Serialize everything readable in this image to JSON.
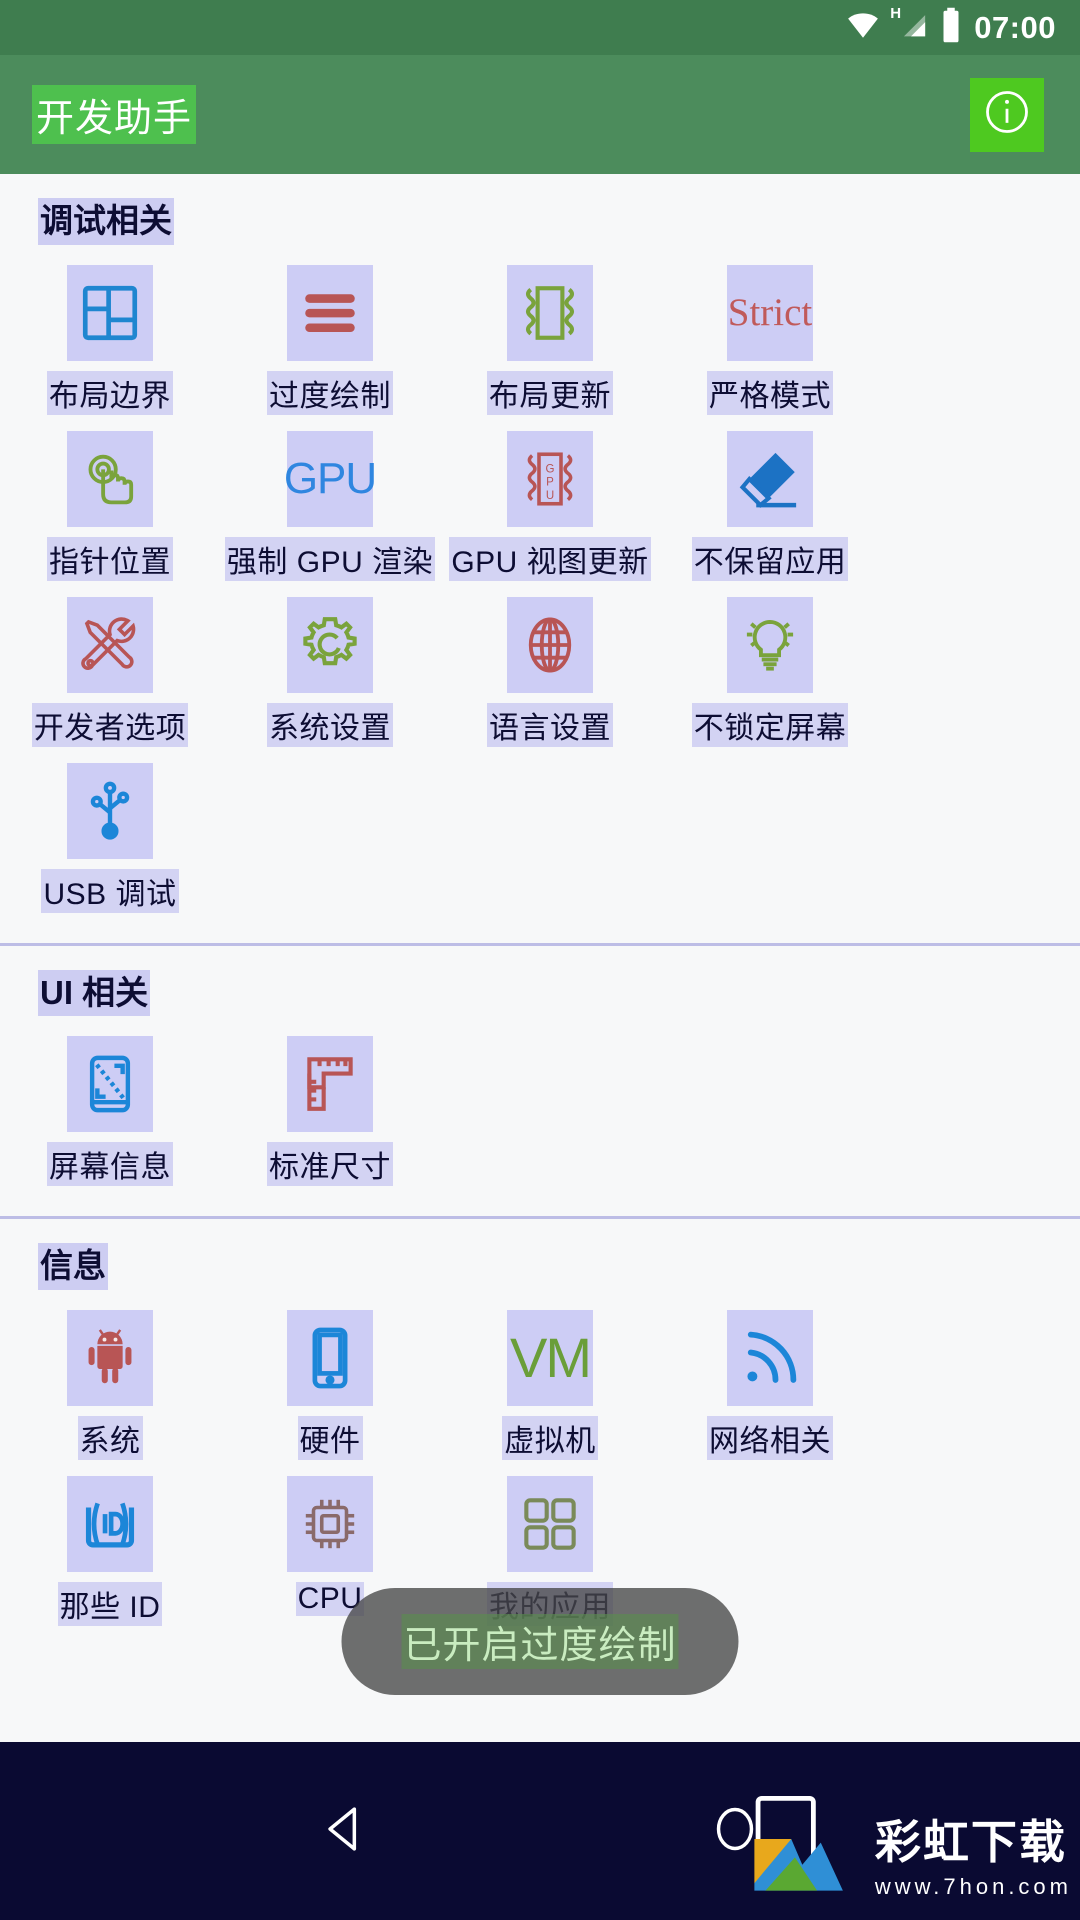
{
  "status_bar": {
    "time": "07:00",
    "icons": [
      "wifi-icon",
      "signal-h-icon",
      "battery-icon"
    ]
  },
  "app_bar": {
    "title": "开发助手",
    "info_button_icon": "info-circle-icon"
  },
  "sections": [
    {
      "title": "调试相关",
      "items": [
        {
          "label": "布局边界",
          "icon": "layout-bounds-icon"
        },
        {
          "label": "过度绘制",
          "icon": "overdraw-lines-icon"
        },
        {
          "label": "布局更新",
          "icon": "layout-update-icon"
        },
        {
          "label": "严格模式",
          "icon": "strict-mode-icon",
          "text": "Strict"
        },
        {
          "label": "指针位置",
          "icon": "pointer-location-icon"
        },
        {
          "label": "强制 GPU 渲染",
          "icon": "gpu-render-icon",
          "text": "GPU"
        },
        {
          "label": "GPU 视图更新",
          "icon": "gpu-view-update-icon",
          "text": "GPU"
        },
        {
          "label": "不保留应用",
          "icon": "dont-keep-activities-icon"
        },
        {
          "label": "开发者选项",
          "icon": "developer-tools-icon"
        },
        {
          "label": "系统设置",
          "icon": "gear-icon"
        },
        {
          "label": "语言设置",
          "icon": "globe-icon"
        },
        {
          "label": "不锁定屏幕",
          "icon": "lightbulb-icon"
        },
        {
          "label": "USB 调试",
          "icon": "usb-icon"
        }
      ]
    },
    {
      "title": "UI 相关",
      "items": [
        {
          "label": "屏幕信息",
          "icon": "screen-info-icon"
        },
        {
          "label": "标准尺寸",
          "icon": "ruler-icon"
        }
      ]
    },
    {
      "title": "信息",
      "items": [
        {
          "label": "系统",
          "icon": "android-robot-icon"
        },
        {
          "label": "硬件",
          "icon": "phone-icon"
        },
        {
          "label": "虚拟机",
          "icon": "vm-icon",
          "text": "VM"
        },
        {
          "label": "网络相关",
          "icon": "wifi-signal-icon"
        },
        {
          "label": "那些 ID",
          "icon": "id-card-icon"
        },
        {
          "label": "CPU",
          "icon": "cpu-chip-icon"
        },
        {
          "label": "我的应用",
          "icon": "my-apps-icon"
        }
      ]
    }
  ],
  "toast": {
    "message": "已开启过度绘制"
  },
  "nav_bar": {
    "back_icon": "back-triangle-icon",
    "home_icon": "home-circle-icon"
  },
  "watermark": {
    "title": "彩虹下载",
    "url": "www.7hon.com",
    "logo_icon": "rainbow-download-logo-icon"
  },
  "colors": {
    "status_bar": "#3f7d4f",
    "app_bar": "#4c8c5c",
    "title_highlight": "#4ec04e",
    "info_button": "#4ec920",
    "overdraw_tint": "#cdcdf5",
    "page_bg": "#f7f8f9",
    "nav_bar": "#0a0a32",
    "label_text": "#0d0d33"
  }
}
